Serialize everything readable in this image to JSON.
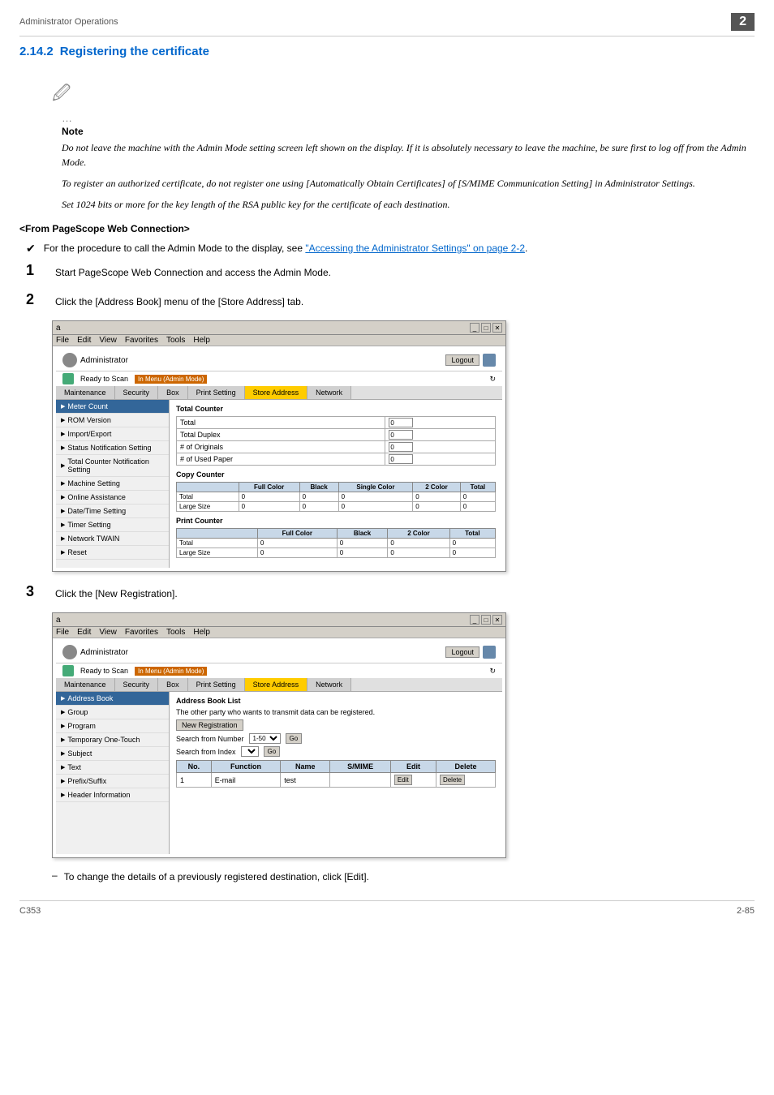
{
  "header": {
    "breadcrumb": "Administrator Operations",
    "page_number": "2"
  },
  "section": {
    "number": "2.14.2",
    "title": "Registering the certificate"
  },
  "note": {
    "label": "Note",
    "lines": [
      "Do not leave the machine with the Admin Mode setting screen left shown on the display. If it is absolutely necessary to leave the machine, be sure first to log off from the Admin Mode.",
      "To register an authorized certificate, do not register one using [Automatically Obtain Certificates] of [S/MIME Communication Setting] in Administrator Settings.",
      "Set 1024 bits or more for the key length of the RSA public key for the certificate of each destination."
    ]
  },
  "from_header": "<From PageScope Web Connection>",
  "check_item": {
    "text_before": "For the procedure to call the Admin Mode to the display, see ",
    "link_text": "\"Accessing the Administrator Settings\" on page 2-2",
    "text_after": "."
  },
  "steps": [
    {
      "num": "1",
      "text": "Start PageScope Web Connection and access the Admin Mode."
    },
    {
      "num": "2",
      "text": "Click the [Address Book] menu of the [Store Address] tab."
    },
    {
      "num": "3",
      "text": "Click the [New Registration]."
    }
  ],
  "browser1": {
    "title": "a",
    "menu_items": [
      "File",
      "Edit",
      "View",
      "Favorites",
      "Tools",
      "Help"
    ],
    "admin_label": "Administrator",
    "logout_label": "Logout",
    "status1": "Ready to Scan",
    "status2": "In Menu (Admin Mode)",
    "tabs": [
      "Maintenance",
      "Security",
      "Box",
      "Print Setting",
      "Store Address",
      "Network"
    ],
    "active_tab": "Store Address",
    "sidebar_items": [
      "Meter Count",
      "ROM Version",
      "Import/Export",
      "Status Notification Setting",
      "Total Counter Notification Setting",
      "Machine Setting",
      "Online Assistance",
      "Date/Time Setting",
      "Timer Setting",
      "Network TWAIN",
      "Reset"
    ],
    "total_counter_label": "Total Counter",
    "counter_rows": [
      {
        "label": "Total",
        "value": "0"
      },
      {
        "label": "Total Duplex",
        "value": "0"
      },
      {
        "label": "# of Originals",
        "value": "0"
      },
      {
        "label": "# of Used Paper",
        "value": "0"
      }
    ],
    "copy_counter_label": "Copy Counter",
    "copy_header": [
      "",
      "Full Color",
      "Black",
      "Single Color",
      "2 Color",
      "Total"
    ],
    "copy_rows": [
      {
        "label": "Total",
        "values": [
          "0",
          "0",
          "0",
          "0",
          "0"
        ]
      },
      {
        "label": "Large Size",
        "values": [
          "0",
          "0",
          "0",
          "0",
          "0"
        ]
      }
    ],
    "print_counter_label": "Print Counter",
    "print_header": [
      "",
      "Full Color",
      "Black",
      "2 Color",
      "Total"
    ],
    "print_rows": [
      {
        "label": "Total",
        "values": [
          "0",
          "0",
          "0",
          "0"
        ]
      },
      {
        "label": "Large Size",
        "values": [
          "0",
          "0",
          "0",
          "0"
        ]
      }
    ]
  },
  "browser2": {
    "title": "a",
    "menu_items": [
      "File",
      "Edit",
      "View",
      "Favorites",
      "Tools",
      "Help"
    ],
    "admin_label": "Administrator",
    "logout_label": "Logout",
    "status1": "Ready to Scan",
    "status2": "In Menu (Admin Mode)",
    "tabs": [
      "Maintenance",
      "Security",
      "Box",
      "Print Setting",
      "Store Address",
      "Network"
    ],
    "active_tab": "Store Address",
    "sidebar_items": [
      "Address Book",
      "Group",
      "Program",
      "Temporary One-Touch",
      "Subject",
      "Text",
      "Prefix/Suffix",
      "Header Information"
    ],
    "active_sidebar": "Address Book",
    "section_title": "Address Book List",
    "description": "The other party who wants to transmit data can be registered.",
    "new_reg_label": "New Registration",
    "search_from_number_label": "Search from Number",
    "search_range": "1-50",
    "search_from_index_label": "Search from Index",
    "go_label": "Go",
    "table_headers": [
      "No.",
      "Function",
      "Name",
      "S/MIME",
      "Edit",
      "Delete"
    ],
    "table_rows": [
      {
        "no": "1",
        "function": "E-mail",
        "name": "test",
        "smime": "",
        "edit": "Edit",
        "delete": "Delete"
      }
    ]
  },
  "dash_note": "To change the details of a previously registered destination, click [Edit].",
  "footer": {
    "left": "C353",
    "right": "2-85"
  }
}
